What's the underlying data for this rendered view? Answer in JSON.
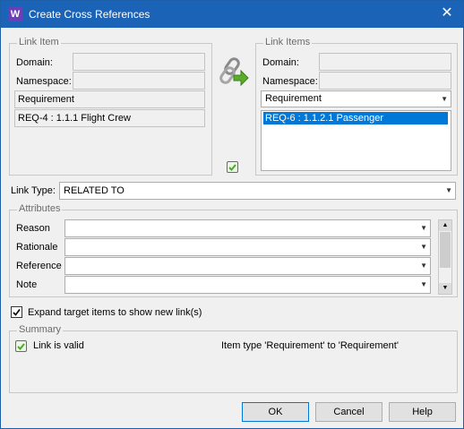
{
  "window": {
    "title": "Create Cross References",
    "app_icon_letter": "W",
    "close_glyph": "✕"
  },
  "link_item": {
    "legend": "Link Item",
    "domain_label": "Domain:",
    "namespace_label": "Namespace:",
    "type_value": "Requirement",
    "item_value": "REQ-4 : 1.1.1 Flight Crew"
  },
  "link_items": {
    "legend": "Link Items",
    "domain_label": "Domain:",
    "namespace_label": "Namespace:",
    "type_value": "Requirement",
    "list": [
      "REQ-6 : 1.1.2.1 Passenger"
    ]
  },
  "link_type": {
    "label": "Link Type:",
    "value": "RELATED TO"
  },
  "attributes": {
    "legend": "Attributes",
    "rows": [
      {
        "label": "Reason",
        "value": ""
      },
      {
        "label": "Rationale",
        "value": ""
      },
      {
        "label": "Reference",
        "value": ""
      },
      {
        "label": "Note",
        "value": ""
      }
    ]
  },
  "expand": {
    "label": "Expand target items to show new link(s)",
    "checked": true
  },
  "summary": {
    "legend": "Summary",
    "status_text": "Link is valid",
    "detail_text": "Item type 'Requirement' to 'Requirement'"
  },
  "buttons": {
    "ok": "OK",
    "cancel": "Cancel",
    "help": "Help"
  },
  "colors": {
    "titlebar": "#1b63b6",
    "selection": "#0078d7",
    "accent_green": "#4ea72e"
  }
}
